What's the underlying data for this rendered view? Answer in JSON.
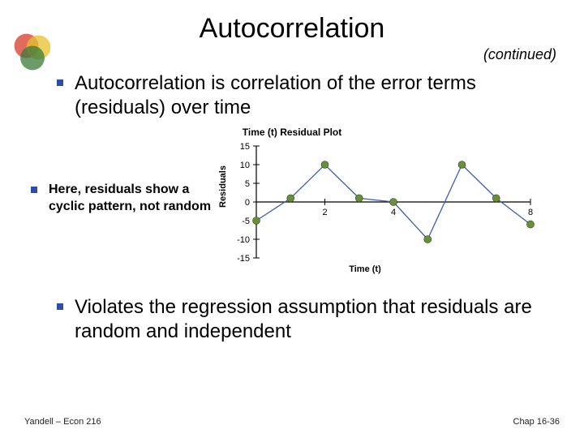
{
  "title": "Autocorrelation",
  "continued": "(continued)",
  "bullets": [
    "Autocorrelation is correlation of the error terms (residuals) over time",
    "Here, residuals show a cyclic pattern, not random",
    "Violates the regression assumption that residuals are random and independent"
  ],
  "chart_data": {
    "type": "scatter",
    "title": "Time (t)  Residual Plot",
    "xlabel": "Time (t)",
    "ylabel": "Residuals",
    "x": [
      0,
      1,
      2,
      3,
      4,
      5,
      6,
      7,
      8
    ],
    "y": [
      -5,
      1,
      10,
      1,
      0,
      -10,
      10,
      1,
      -6
    ],
    "x_ticks": [
      2,
      4,
      8
    ],
    "y_ticks": [
      -15,
      -10,
      -5,
      0,
      5,
      10,
      15
    ],
    "xlim": [
      0,
      8
    ],
    "ylim": [
      -15,
      15
    ],
    "point_color": "#6a8f3a",
    "line_color": "#3a5fb0"
  },
  "footer": {
    "left": "Yandell – Econ 216",
    "right": "Chap 16-36"
  }
}
